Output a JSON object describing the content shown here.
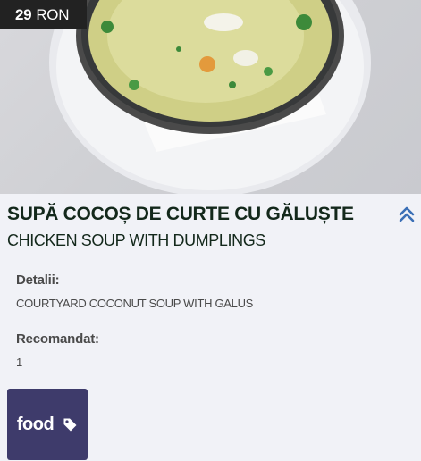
{
  "item": {
    "price_amount": "29",
    "price_currency": "RON",
    "title": "SUPĂ COCOȘ DE CURTE CU GĂLUȘTE",
    "subtitle": "CHICKEN SOUP WITH DUMPLINGS",
    "image": "soup-bowl-photo",
    "collapse_icon": "double-chevron-up-icon"
  },
  "details": {
    "label": "Detalii:",
    "value": "COURTYARD COCONUT SOUP WITH GALUS"
  },
  "recommended": {
    "label": "Recomandat:",
    "value": "1"
  },
  "tag": {
    "label": "food",
    "icon": "tag-icon"
  },
  "colors": {
    "accent": "#3e3b6b",
    "chevron": "#3b6fb6",
    "title": "#13281b",
    "badge": "#222222"
  }
}
